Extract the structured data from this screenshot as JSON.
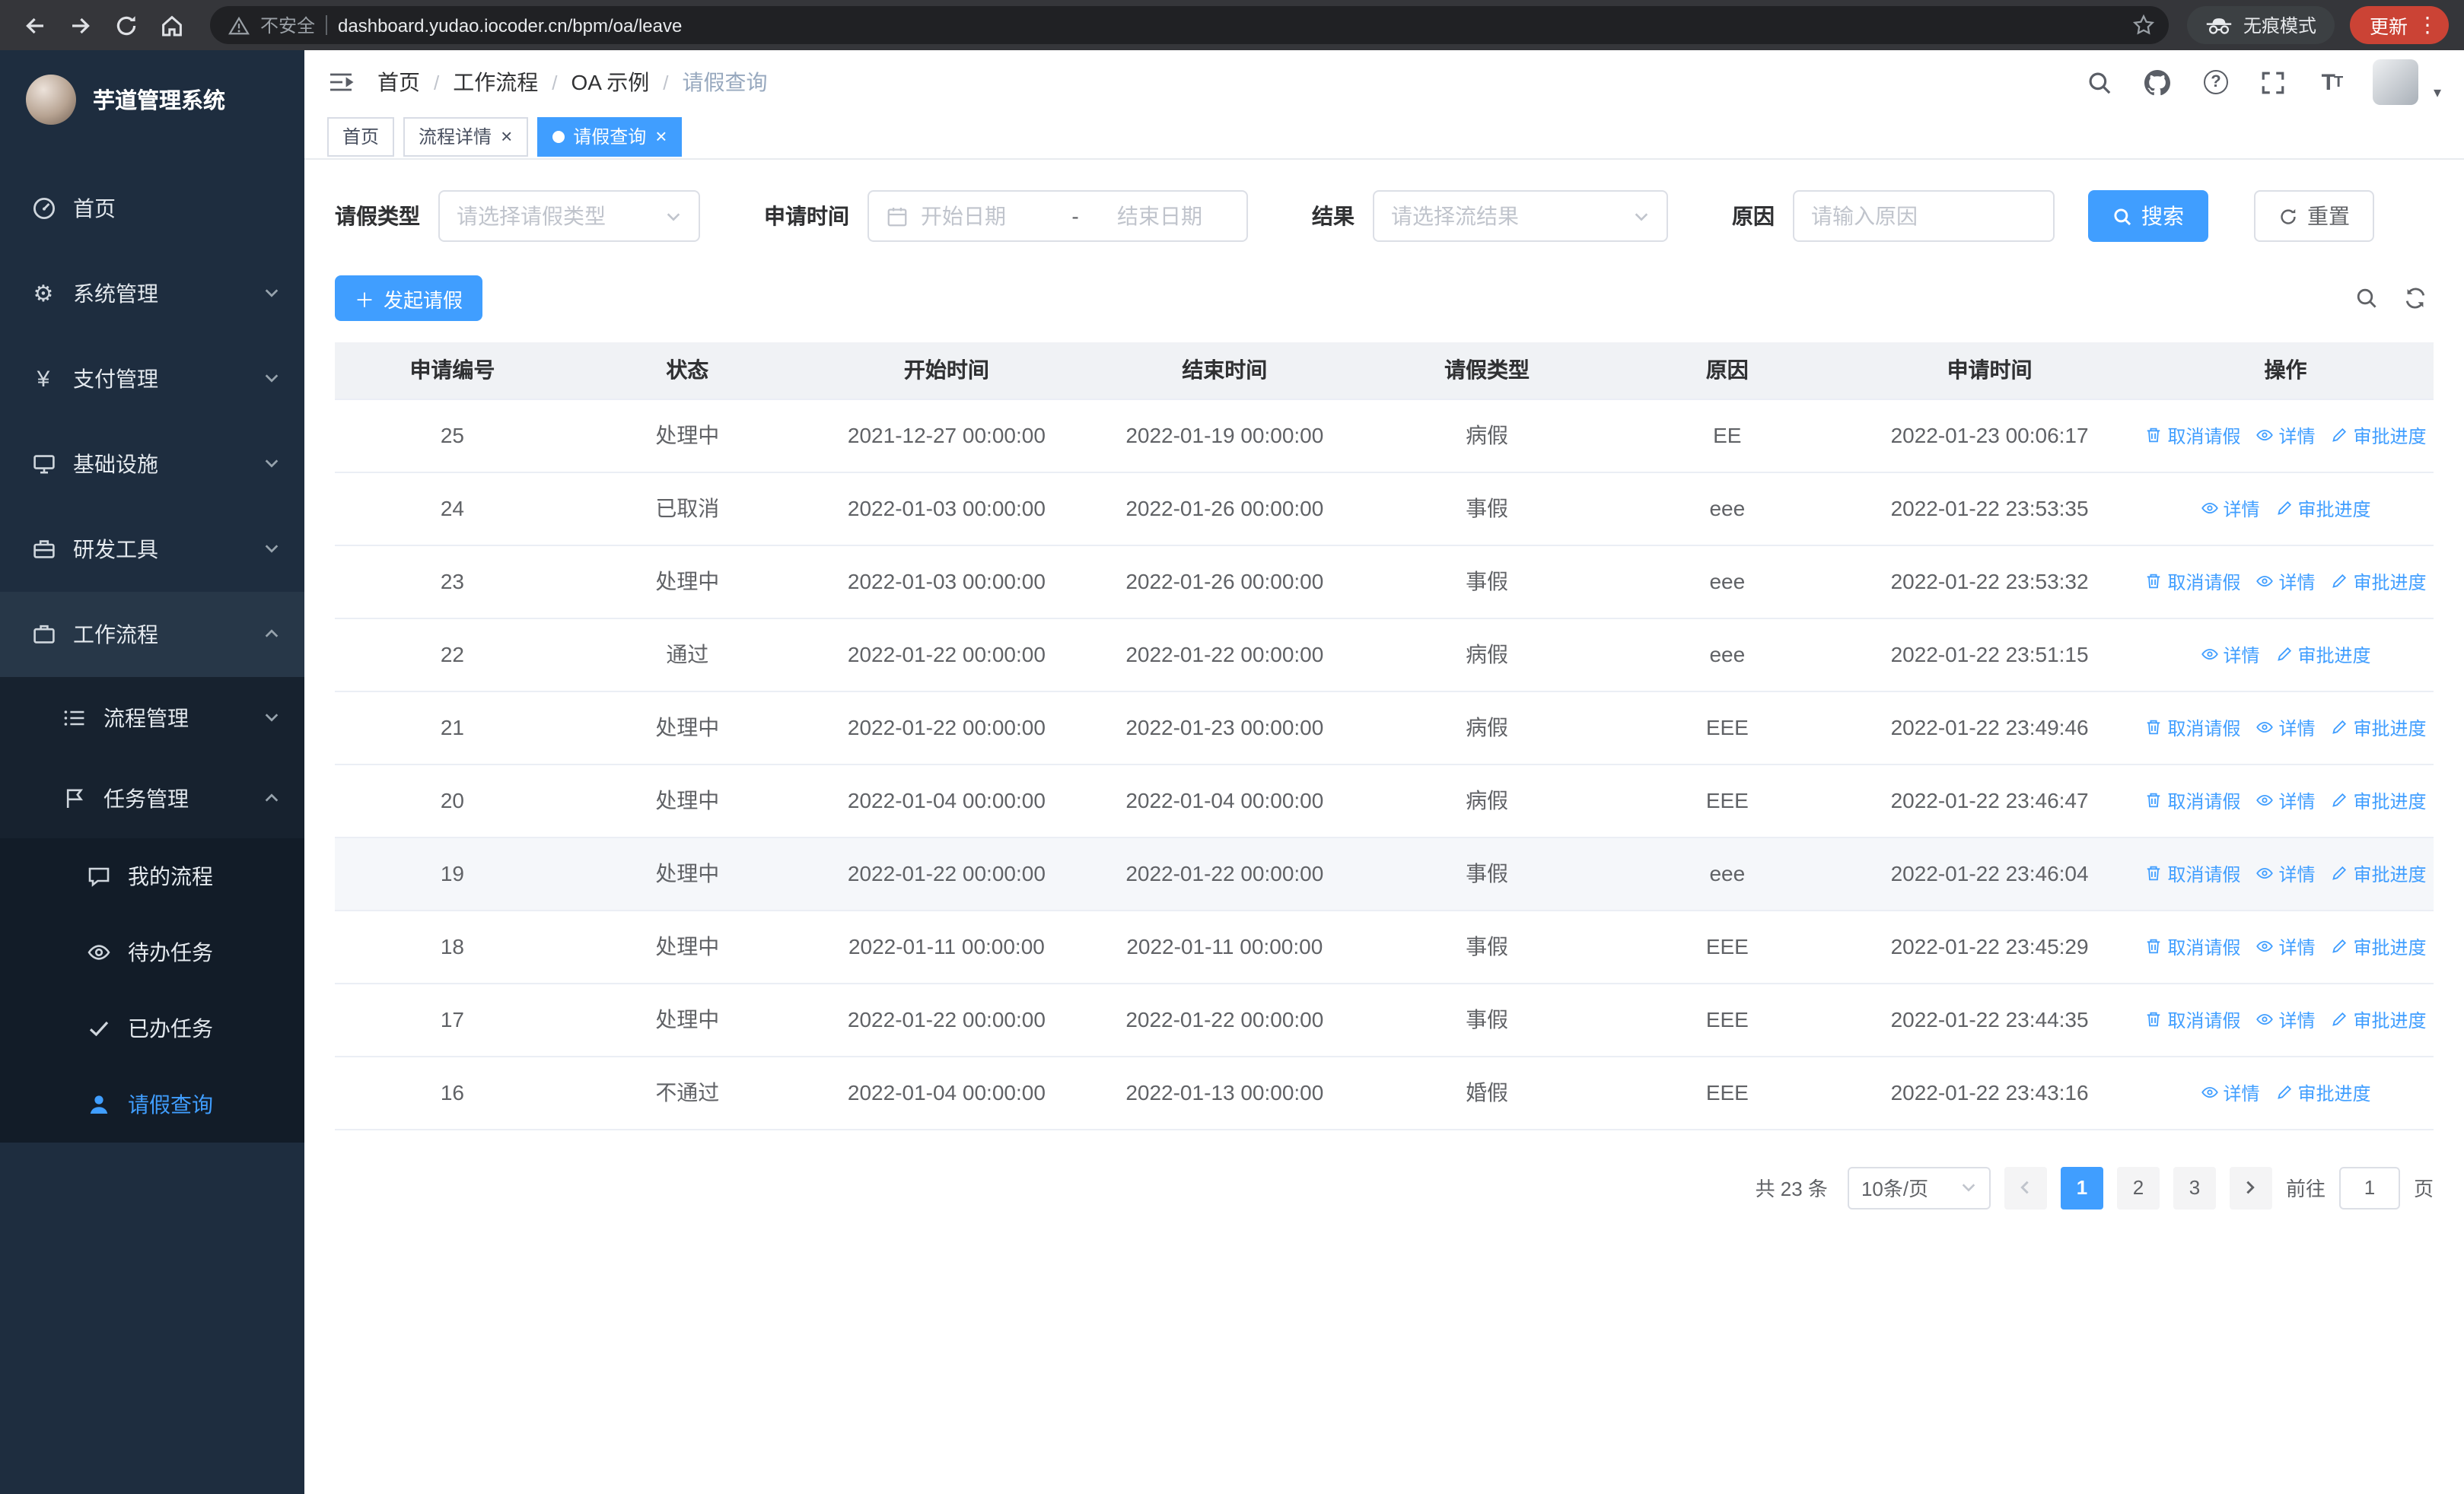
{
  "browser": {
    "security_label": "不安全",
    "url": "dashboard.yudao.iocoder.cn/bpm/oa/leave",
    "incognito_label": "无痕模式",
    "update_label": "更新"
  },
  "sidebar": {
    "logo_title": "芋道管理系统",
    "home": "首页",
    "system": "系统管理",
    "payment": "支付管理",
    "infra": "基础设施",
    "devtools": "研发工具",
    "workflow": "工作流程",
    "process_mgmt": "流程管理",
    "task_mgmt": "任务管理",
    "my_process": "我的流程",
    "todo_task": "待办任务",
    "done_task": "已办任务",
    "leave_query": "请假查询"
  },
  "header": {
    "breadcrumb": [
      "首页",
      "工作流程",
      "OA 示例",
      "请假查询"
    ],
    "breadcrumb_separator": "/"
  },
  "tabs": [
    {
      "label": "首页"
    },
    {
      "label": "流程详情"
    },
    {
      "label": "请假查询"
    }
  ],
  "filters": {
    "leave_type_label": "请假类型",
    "leave_type_placeholder": "请选择请假类型",
    "apply_time_label": "申请时间",
    "start_date_placeholder": "开始日期",
    "range_separator": "-",
    "end_date_placeholder": "结束日期",
    "result_label": "结果",
    "result_placeholder": "请选择流结果",
    "reason_label": "原因",
    "reason_placeholder": "请输入原因",
    "search_button": "搜索",
    "reset_button": "重置"
  },
  "toolbar": {
    "create_button": "发起请假"
  },
  "table": {
    "columns": [
      "申请编号",
      "状态",
      "开始时间",
      "结束时间",
      "请假类型",
      "原因",
      "申请时间",
      "操作"
    ],
    "action_labels": {
      "cancel": "取消请假",
      "detail": "详情",
      "progress": "审批进度"
    },
    "rows": [
      {
        "id": "25",
        "status": "处理中",
        "start": "2021-12-27 00:00:00",
        "end": "2022-01-19 00:00:00",
        "type": "病假",
        "reason": "EE",
        "applied": "2022-01-23 00:06:17",
        "can_cancel": true,
        "highlighted": false
      },
      {
        "id": "24",
        "status": "已取消",
        "start": "2022-01-03 00:00:00",
        "end": "2022-01-26 00:00:00",
        "type": "事假",
        "reason": "eee",
        "applied": "2022-01-22 23:53:35",
        "can_cancel": false,
        "highlighted": false
      },
      {
        "id": "23",
        "status": "处理中",
        "start": "2022-01-03 00:00:00",
        "end": "2022-01-26 00:00:00",
        "type": "事假",
        "reason": "eee",
        "applied": "2022-01-22 23:53:32",
        "can_cancel": true,
        "highlighted": false
      },
      {
        "id": "22",
        "status": "通过",
        "start": "2022-01-22 00:00:00",
        "end": "2022-01-22 00:00:00",
        "type": "病假",
        "reason": "eee",
        "applied": "2022-01-22 23:51:15",
        "can_cancel": false,
        "highlighted": false
      },
      {
        "id": "21",
        "status": "处理中",
        "start": "2022-01-22 00:00:00",
        "end": "2022-01-23 00:00:00",
        "type": "病假",
        "reason": "EEE",
        "applied": "2022-01-22 23:49:46",
        "can_cancel": true,
        "highlighted": false
      },
      {
        "id": "20",
        "status": "处理中",
        "start": "2022-01-04 00:00:00",
        "end": "2022-01-04 00:00:00",
        "type": "病假",
        "reason": "EEE",
        "applied": "2022-01-22 23:46:47",
        "can_cancel": true,
        "highlighted": false
      },
      {
        "id": "19",
        "status": "处理中",
        "start": "2022-01-22 00:00:00",
        "end": "2022-01-22 00:00:00",
        "type": "事假",
        "reason": "eee",
        "applied": "2022-01-22 23:46:04",
        "can_cancel": true,
        "highlighted": true
      },
      {
        "id": "18",
        "status": "处理中",
        "start": "2022-01-11 00:00:00",
        "end": "2022-01-11 00:00:00",
        "type": "事假",
        "reason": "EEE",
        "applied": "2022-01-22 23:45:29",
        "can_cancel": true,
        "highlighted": false
      },
      {
        "id": "17",
        "status": "处理中",
        "start": "2022-01-22 00:00:00",
        "end": "2022-01-22 00:00:00",
        "type": "事假",
        "reason": "EEE",
        "applied": "2022-01-22 23:44:35",
        "can_cancel": true,
        "highlighted": false
      },
      {
        "id": "16",
        "status": "不通过",
        "start": "2022-01-04 00:00:00",
        "end": "2022-01-13 00:00:00",
        "type": "婚假",
        "reason": "EEE",
        "applied": "2022-01-22 23:43:16",
        "can_cancel": false,
        "highlighted": false
      }
    ]
  },
  "pagination": {
    "total_label": "共 23 条",
    "page_size_label": "10条/页",
    "pages": [
      "1",
      "2",
      "3"
    ],
    "active_page": "1",
    "goto_prefix": "前往",
    "goto_value": "1",
    "goto_suffix": "页"
  },
  "colors": {
    "primary": "#409eff",
    "sidebar_bg": "#1e2d3f",
    "update_pill": "#cb4335"
  }
}
